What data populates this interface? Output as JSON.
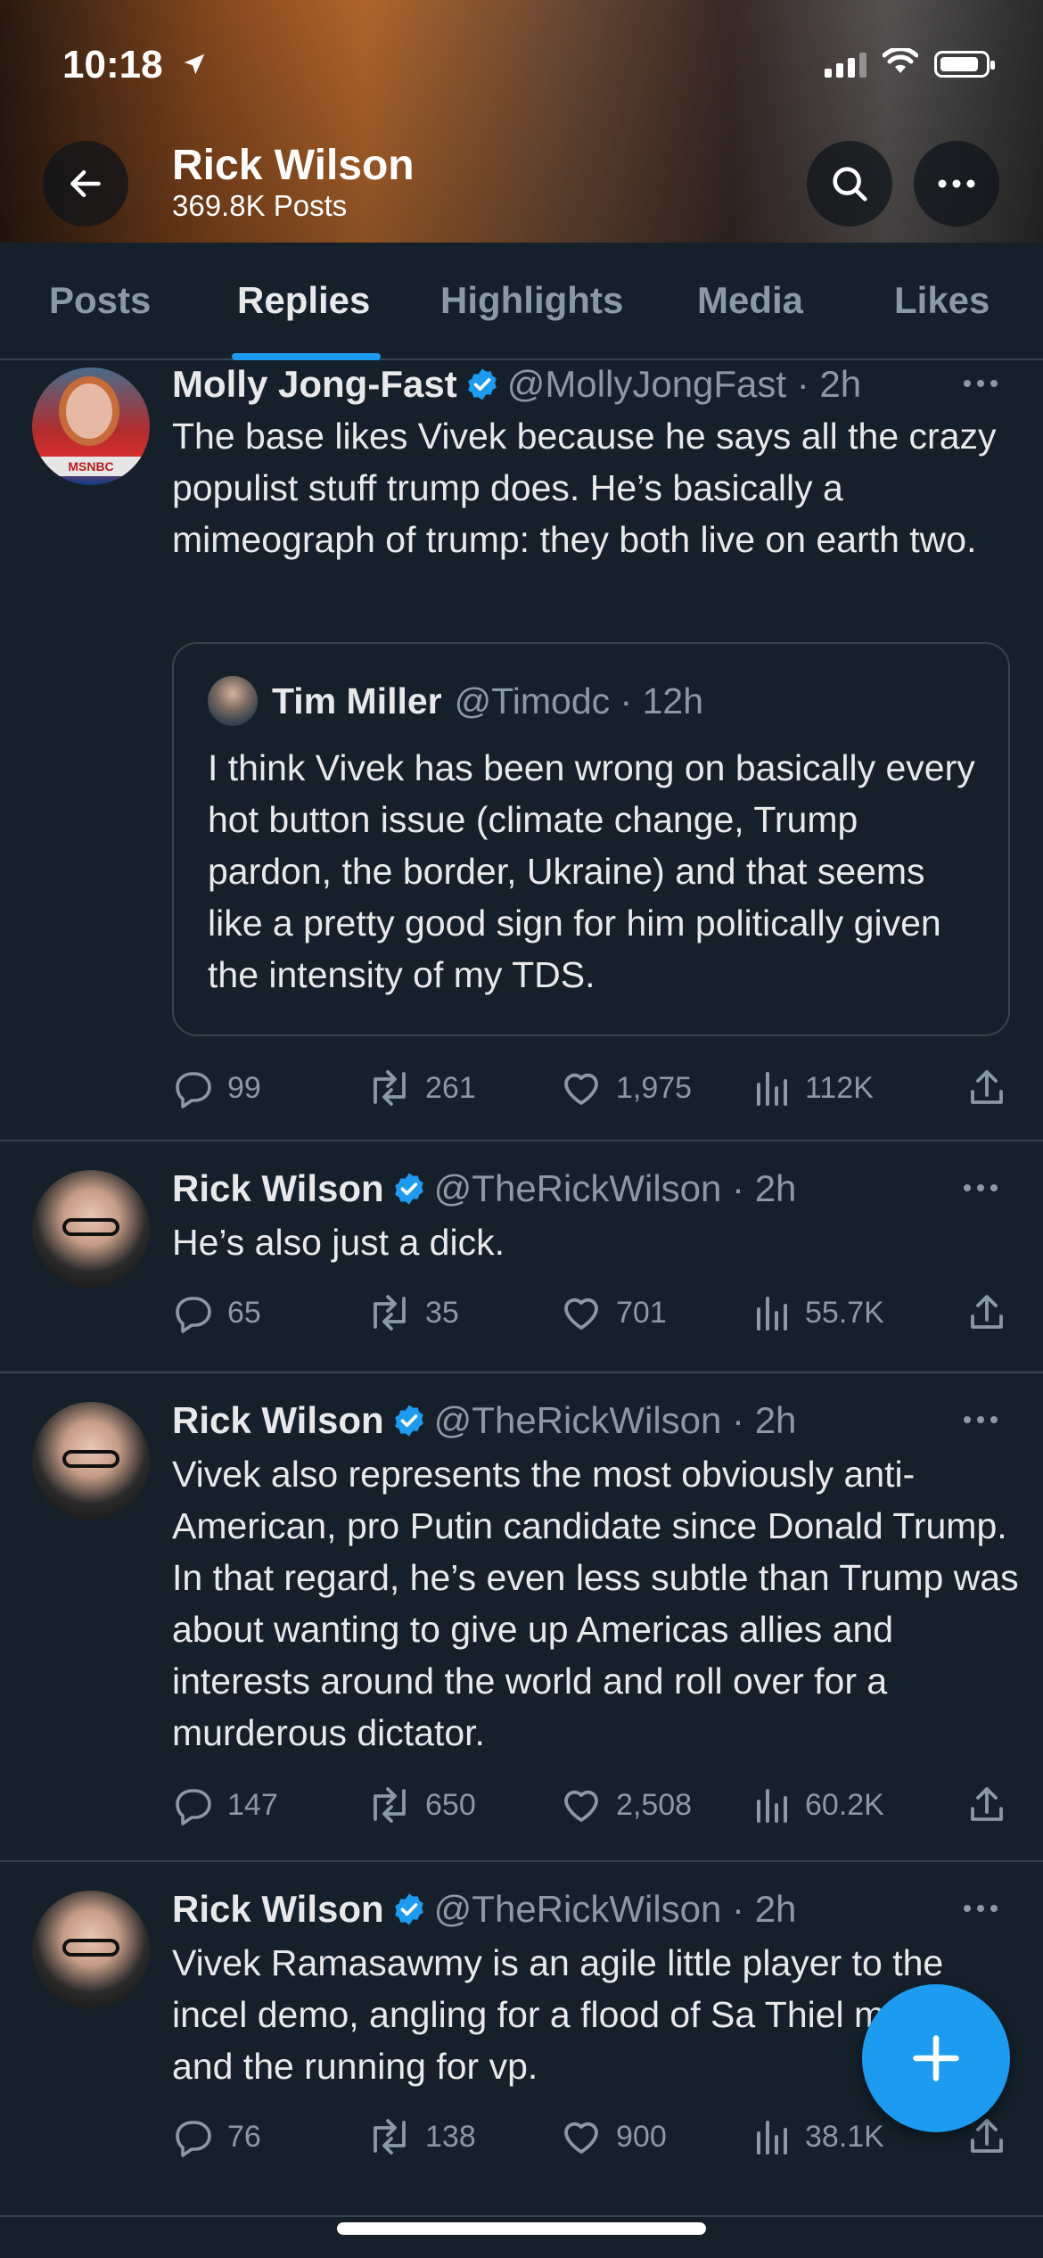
{
  "status_bar": {
    "time": "10:18"
  },
  "profile": {
    "name": "Rick Wilson",
    "posts_count": "369.8K Posts"
  },
  "tabs": [
    {
      "label": "Posts",
      "active": false
    },
    {
      "label": "Replies",
      "active": true
    },
    {
      "label": "Highlights",
      "active": false
    },
    {
      "label": "Media",
      "active": false
    },
    {
      "label": "Likes",
      "active": false
    }
  ],
  "tweets": [
    {
      "author": "Molly Jong-Fast",
      "handle": "@MollyJongFast",
      "time": "2h",
      "avatar_badge": "MSNBC",
      "text": "The base likes Vivek because he says all the crazy populist stuff trump does. He’s basically a mimeograph of trump: they both live on earth two.",
      "quote": {
        "author": "Tim Miller",
        "handle": "@Timodc",
        "time": "12h",
        "text": "I think Vivek has been wrong on basically every hot button issue (climate change, Trump pardon, the border, Ukraine) and that seems like a pretty good sign for him politically given the intensity of my TDS."
      },
      "stats": {
        "replies": "99",
        "reposts": "261",
        "likes": "1,975",
        "views": "112K"
      }
    },
    {
      "author": "Rick Wilson",
      "handle": "@TheRickWilson",
      "time": "2h",
      "text": "He’s also just a dick.",
      "stats": {
        "replies": "65",
        "reposts": "35",
        "likes": "701",
        "views": "55.7K"
      }
    },
    {
      "author": "Rick Wilson",
      "handle": "@TheRickWilson",
      "time": "2h",
      "text": "Vivek also represents the most obviously anti-American, pro Putin candidate since Donald Trump. In that regard, he’s even less subtle than Trump was about wanting to give up Americas allies and interests around the world and roll over for a murderous dictator.",
      "stats": {
        "replies": "147",
        "reposts": "650",
        "likes": "2,508",
        "views": "60.2K"
      }
    },
    {
      "author": "Rick Wilson",
      "handle": "@TheRickWilson",
      "time": "2h",
      "text": "Vivek Ramasawmy is an agile little player to the incel demo, angling for a flood of Sa Thiel money, and the running for vp.",
      "stats": {
        "replies": "76",
        "reposts": "138",
        "likes": "900",
        "views": "38.1K"
      }
    }
  ],
  "colors": {
    "accent": "#1d9bf0",
    "background": "#15202b",
    "secondary_text": "#8b98a5",
    "border": "#38444d"
  },
  "icons": [
    "back-arrow-icon",
    "search-icon",
    "more-icon",
    "verified-icon",
    "reply-icon",
    "repost-icon",
    "like-icon",
    "views-icon",
    "share-icon",
    "plus-icon",
    "location-arrow-icon",
    "wifi-icon",
    "battery-icon"
  ]
}
